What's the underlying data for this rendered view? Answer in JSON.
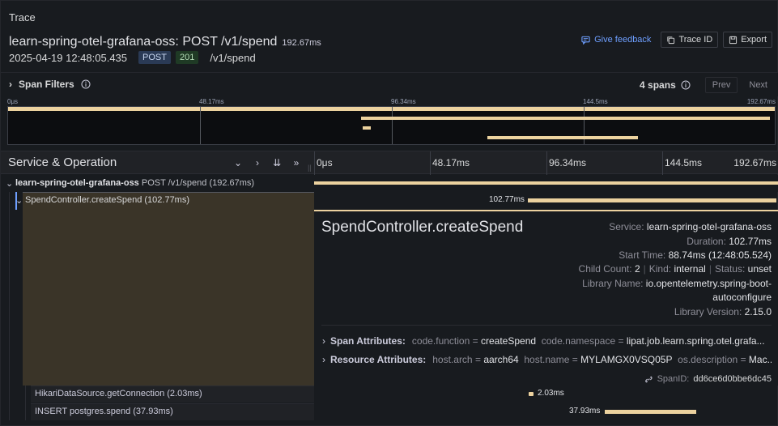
{
  "panel": {
    "title": "Trace"
  },
  "trace": {
    "name": "learn-spring-otel-grafana-oss: POST /v1/spend",
    "duration": "192.67ms",
    "timestamp": "2025-04-19 12:48:05.435",
    "method": "POST",
    "status": "201",
    "path": "/v1/spend"
  },
  "actions": {
    "feedback": "Give feedback",
    "trace_id": "Trace ID",
    "export": "Export"
  },
  "filters": {
    "label": "Span Filters",
    "spans_count": "4 spans",
    "prev": "Prev",
    "next": "Next"
  },
  "minimap": {
    "ticks": [
      "0μs",
      "48.17ms",
      "96.34ms",
      "144.5ms",
      "192.67ms"
    ]
  },
  "ops": {
    "title": "Service & Operation",
    "ticks": [
      "0μs",
      "48.17ms",
      "96.34ms",
      "144.5ms",
      "192.67ms"
    ]
  },
  "rows": [
    {
      "service": "learn-spring-otel-grafana-oss",
      "op": "POST /v1/spend (192.67ms)"
    },
    {
      "op": "SpendController.createSpend (102.77ms)",
      "dur_label": "102.77ms"
    },
    {
      "op": "HikariDataSource.getConnection (2.03ms)",
      "dur_label": "2.03ms"
    },
    {
      "op": "INSERT postgres.spend (37.93ms)",
      "dur_label": "37.93ms"
    }
  ],
  "detail": {
    "title": "SpendController.createSpend",
    "service_k": "Service:",
    "service_v": "learn-spring-otel-grafana-oss",
    "duration_k": "Duration:",
    "duration_v": "102.77ms",
    "start_k": "Start Time:",
    "start_v": "88.74ms (12:48:05.524)",
    "child_k": "Child Count:",
    "child_v": "2",
    "kind_k": "Kind:",
    "kind_v": "internal",
    "status_k": "Status:",
    "status_v": "unset",
    "lib_k": "Library Name:",
    "lib_v1": "io.opentelemetry.spring-boot-",
    "lib_v2": "autoconfigure",
    "libver_k": "Library Version:",
    "libver_v": "2.15.0",
    "span_attrs": "Span Attributes:",
    "sa1_k": "code.function",
    "sa1_v": "createSpend",
    "sa2_k": "code.namespace",
    "sa2_v": "lipat.job.learn.spring.otel.grafa...",
    "res_attrs": "Resource Attributes:",
    "ra1_k": "host.arch",
    "ra1_v": "aarch64",
    "ra2_k": "host.name",
    "ra2_v": "MYLAMGX0VSQ05P",
    "ra3_k": "os.description",
    "ra3_v": "Mac...",
    "spanid_k": "SpanID:",
    "spanid_v": "dd6ce6d0bbe6dc45",
    "eq": "="
  },
  "colors": {
    "bar": "#ecd29f",
    "accent": "#6e9fff",
    "bg": "#181b1f"
  }
}
